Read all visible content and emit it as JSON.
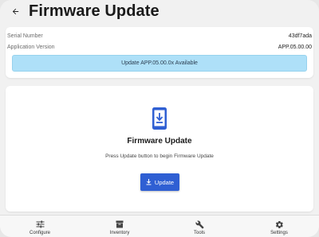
{
  "header": {
    "title": "Firmware Update",
    "back_icon": "arrow-left-icon"
  },
  "device_info": {
    "serial_label": "Serial Number",
    "serial_value": "43df7ada",
    "app_version_label": "Application Version",
    "app_version_value": "APP.05.00.00",
    "update_banner": "Update APP.05.00.0x Available"
  },
  "main": {
    "icon": "phone-download-icon",
    "title": "Firmware Update",
    "description": "Press Update button to begin Firmware Update",
    "button_label": "Update",
    "button_icon": "download-icon"
  },
  "bottom_nav": {
    "items": [
      {
        "label": "Configure",
        "icon": "sliders-icon"
      },
      {
        "label": "Inventory",
        "icon": "archive-icon"
      },
      {
        "label": "Tools",
        "icon": "wrench-icon"
      },
      {
        "label": "Settings",
        "icon": "gear-icon"
      }
    ]
  },
  "colors": {
    "accent": "#2f5fd3",
    "banner_bg": "#aee0f8",
    "background": "#f1f1f1"
  }
}
